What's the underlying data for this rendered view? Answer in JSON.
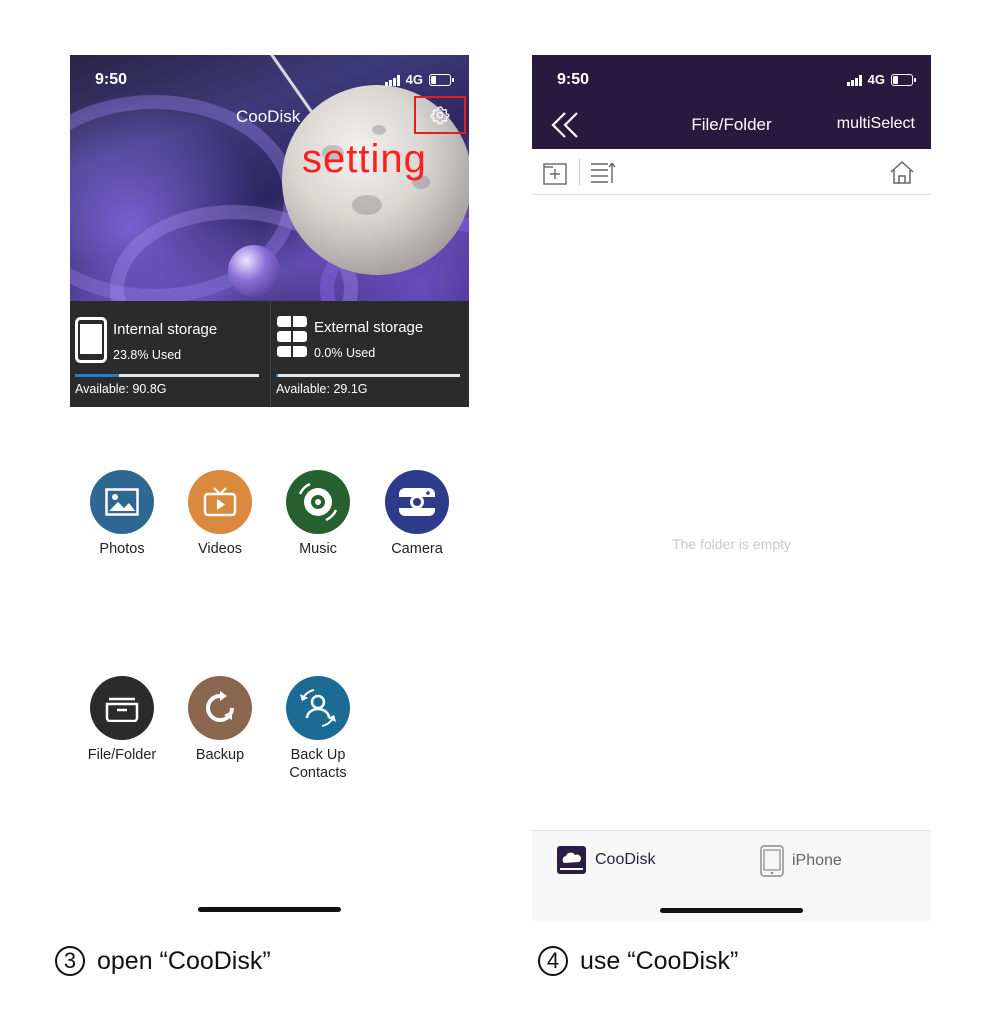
{
  "left": {
    "status": {
      "time": "9:50",
      "network": "4G"
    },
    "hero": {
      "app_title": "CooDisk",
      "annotation": "setting"
    },
    "storage": {
      "internal": {
        "label": "Internal storage",
        "used": "23.8% Used",
        "used_fraction": 0.238,
        "available": "Available: 90.8G"
      },
      "external": {
        "label": "External storage",
        "used": "0.0% Used",
        "used_fraction": 0.0,
        "available": "Available: 29.1G"
      }
    },
    "apps": [
      {
        "label": "Photos",
        "color": "#2e6792",
        "icon": "photo-icon"
      },
      {
        "label": "Videos",
        "color": "#da8a3c",
        "icon": "tv-icon"
      },
      {
        "label": "Music",
        "color": "#26602f",
        "icon": "music-disc-icon"
      },
      {
        "label": "Camera",
        "color": "#2e3a8c",
        "icon": "camera-icon"
      },
      {
        "label": "File/Folder",
        "color": "#2b2b2b",
        "icon": "folder-icon"
      },
      {
        "label": "Backup",
        "color": "#8b6650",
        "icon": "backup-icon"
      },
      {
        "label": "Back Up Contacts",
        "label_line1": "Back Up",
        "label_line2": "Contacts",
        "color": "#1b6b95",
        "icon": "contacts-sync-icon"
      }
    ],
    "caption": {
      "number": "3",
      "text": "open “CooDisk”"
    }
  },
  "right": {
    "status": {
      "time": "9:50",
      "network": "4G"
    },
    "navbar": {
      "title": "File/Folder",
      "action": "multiSelect"
    },
    "empty_message": "The folder is empty",
    "tabs": [
      {
        "label": "CooDisk",
        "icon": "coodisk-drive-icon",
        "selected": true
      },
      {
        "label": "iPhone",
        "icon": "iphone-icon",
        "selected": false
      }
    ],
    "caption": {
      "number": "4",
      "text": "use “CooDisk”"
    }
  },
  "colors": {
    "navbar_bg": "#28193f",
    "annotation_red": "#e0201c",
    "progress_blue": "#1e7fd1",
    "storage_bg": "#2b2b2b"
  }
}
